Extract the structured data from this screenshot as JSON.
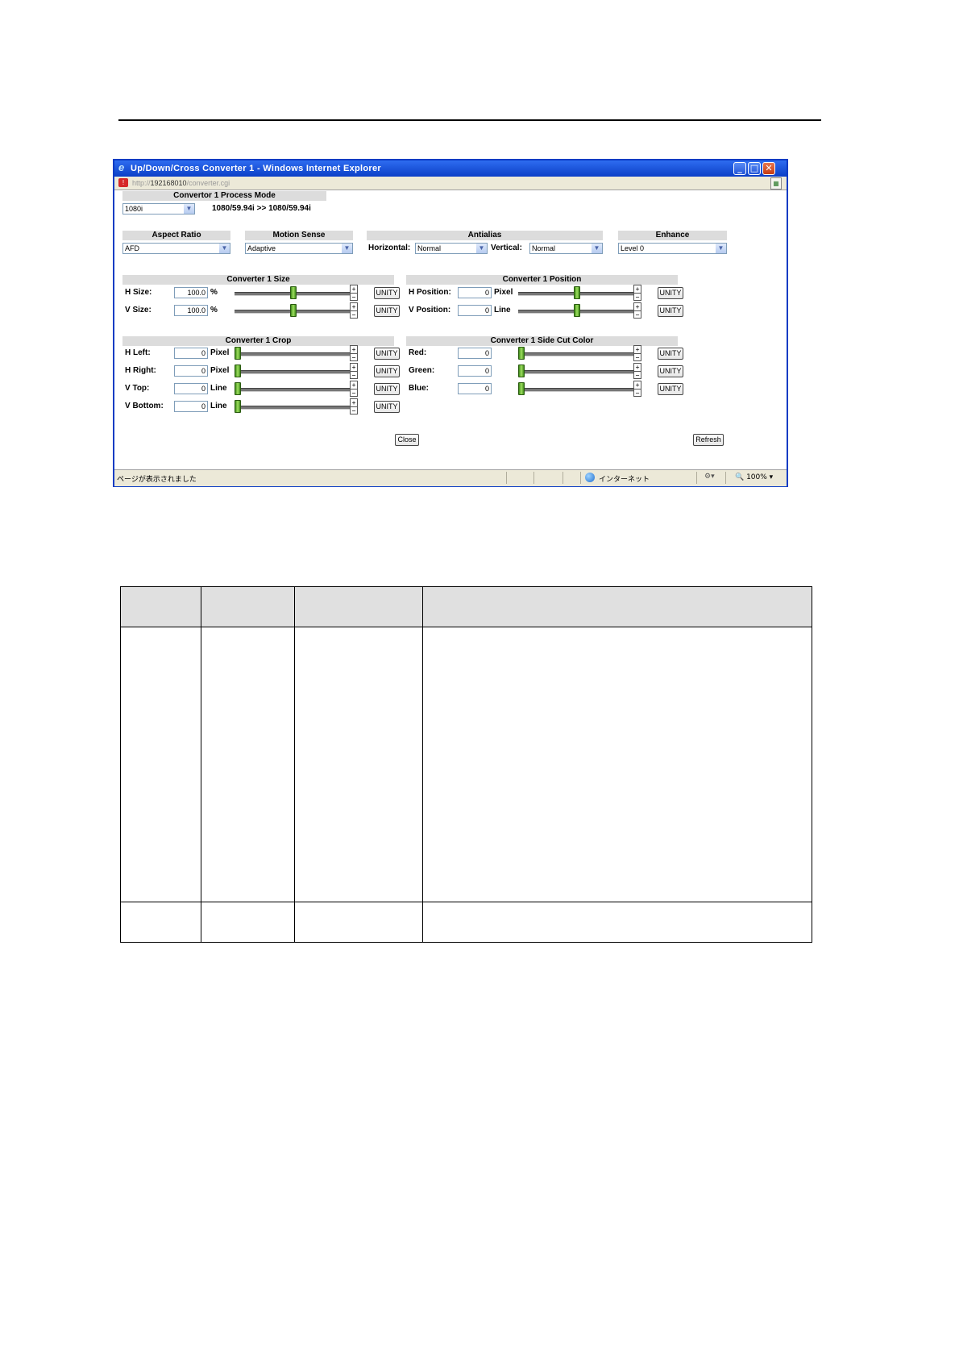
{
  "window": {
    "title": "Up/Down/Cross Converter 1 - Windows Internet Explorer",
    "url_prefix": "http://",
    "url_host": "192168010",
    "url_path": "/converter.cgi",
    "status_text": "ページが表示されました",
    "zone_text": "インターネット",
    "zoom_text": "100%"
  },
  "process_mode": {
    "header": "Convertor 1 Process Mode",
    "selected": "1080i",
    "info": "1080/59.94i >> 1080/59.94i"
  },
  "aspect_ratio": {
    "header": "Aspect Ratio",
    "selected": "AFD"
  },
  "motion_sense": {
    "header": "Motion Sense",
    "selected": "Adaptive"
  },
  "antialias": {
    "header": "Antialias",
    "horizontal_label": "Horizontal:",
    "horizontal_value": "Normal",
    "vertical_label": "Vertical:",
    "vertical_value": "Normal"
  },
  "enhance": {
    "header": "Enhance",
    "selected": "Level 0"
  },
  "size": {
    "header": "Converter 1 Size",
    "rows": [
      {
        "label": "H Size:",
        "value": "100.0",
        "unit": "%",
        "level": 0.5,
        "unity": "UNITY"
      },
      {
        "label": "V Size:",
        "value": "100.0",
        "unit": "%",
        "level": 0.5,
        "unity": "UNITY"
      }
    ]
  },
  "position": {
    "header": "Converter 1 Position",
    "rows": [
      {
        "label": "H Position:",
        "value": "0",
        "unit": "Pixel",
        "level": 0.5,
        "unity": "UNITY"
      },
      {
        "label": "V Position:",
        "value": "0",
        "unit": "Line",
        "level": 0.5,
        "unity": "UNITY"
      }
    ]
  },
  "crop": {
    "header": "Converter 1 Crop",
    "rows": [
      {
        "label": "H Left:",
        "value": "0",
        "unit": "Pixel",
        "level": 0,
        "unity": "UNITY"
      },
      {
        "label": "H Right:",
        "value": "0",
        "unit": "Pixel",
        "level": 0,
        "unity": "UNITY"
      },
      {
        "label": "V Top:",
        "value": "0",
        "unit": "Line",
        "level": 0,
        "unity": "UNITY"
      },
      {
        "label": "V Bottom:",
        "value": "0",
        "unit": "Line",
        "level": 0,
        "unity": "UNITY"
      }
    ]
  },
  "side_cut": {
    "header": "Converter 1 Side Cut Color",
    "rows": [
      {
        "label": "Red:",
        "value": "0",
        "unit": "",
        "level": 0,
        "unity": "UNITY"
      },
      {
        "label": "Green:",
        "value": "0",
        "unit": "",
        "level": 0,
        "unity": "UNITY"
      },
      {
        "label": "Blue:",
        "value": "0",
        "unit": "",
        "level": 0,
        "unity": "UNITY"
      }
    ]
  },
  "buttons": {
    "close": "Close",
    "refresh": "Refresh"
  }
}
